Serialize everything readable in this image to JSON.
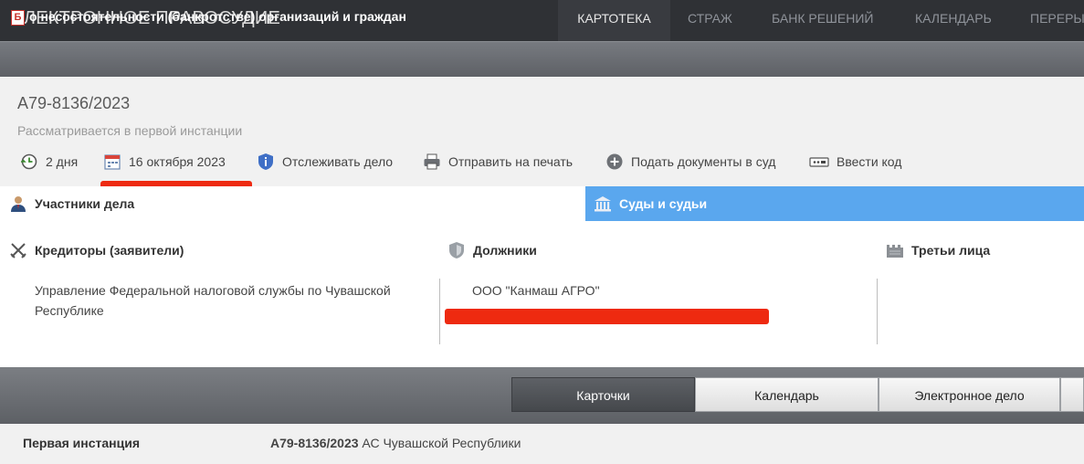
{
  "header": {
    "logo": "ЭЛЕКТРОННОЕ ПРАВОСУДИЕ",
    "nav": [
      "КАРТОТЕКА",
      "СТРАЖ",
      "БАНК РЕШЕНИЙ",
      "КАЛЕНДАРЬ",
      "ПЕРЕРЫ"
    ],
    "active_nav": "КАРТОТЕКА"
  },
  "category": {
    "badge": "Б",
    "title": "о несостоятельности (банкротстве) организаций и граждан"
  },
  "case": {
    "number": "А79-8136/2023",
    "status": "Рассматривается в первой инстанции",
    "toolbar": {
      "duration": "2 дня",
      "date": "16 октября 2023",
      "track": "Отслеживать дело",
      "print": "Отправить на печать",
      "submit": "Подать документы в суд",
      "code": "Ввести код"
    }
  },
  "sections": {
    "participants": "Участники дела",
    "courts": "Суды и судьи"
  },
  "parties": {
    "creditors": {
      "title": "Кредиторы (заявители)",
      "items": [
        "Управление Федеральной налоговой службы по Чувашской Республике"
      ]
    },
    "debtors": {
      "title": "Должники",
      "items": [
        "ООО \"Канмаш АГРО\""
      ]
    },
    "third": {
      "title": "Третьи лица",
      "items": []
    }
  },
  "bottom_tabs": [
    "Карточки",
    "Календарь",
    "Электронное дело"
  ],
  "active_bottom_tab": "Карточки",
  "instance": {
    "label": "Первая инстанция",
    "number": "А79-8136/2023",
    "court": "АС Чувашской Республики"
  },
  "colors": {
    "accent_blue": "#5aa7ee",
    "redaction": "#ee2a10",
    "topbar": "#2f3135"
  }
}
